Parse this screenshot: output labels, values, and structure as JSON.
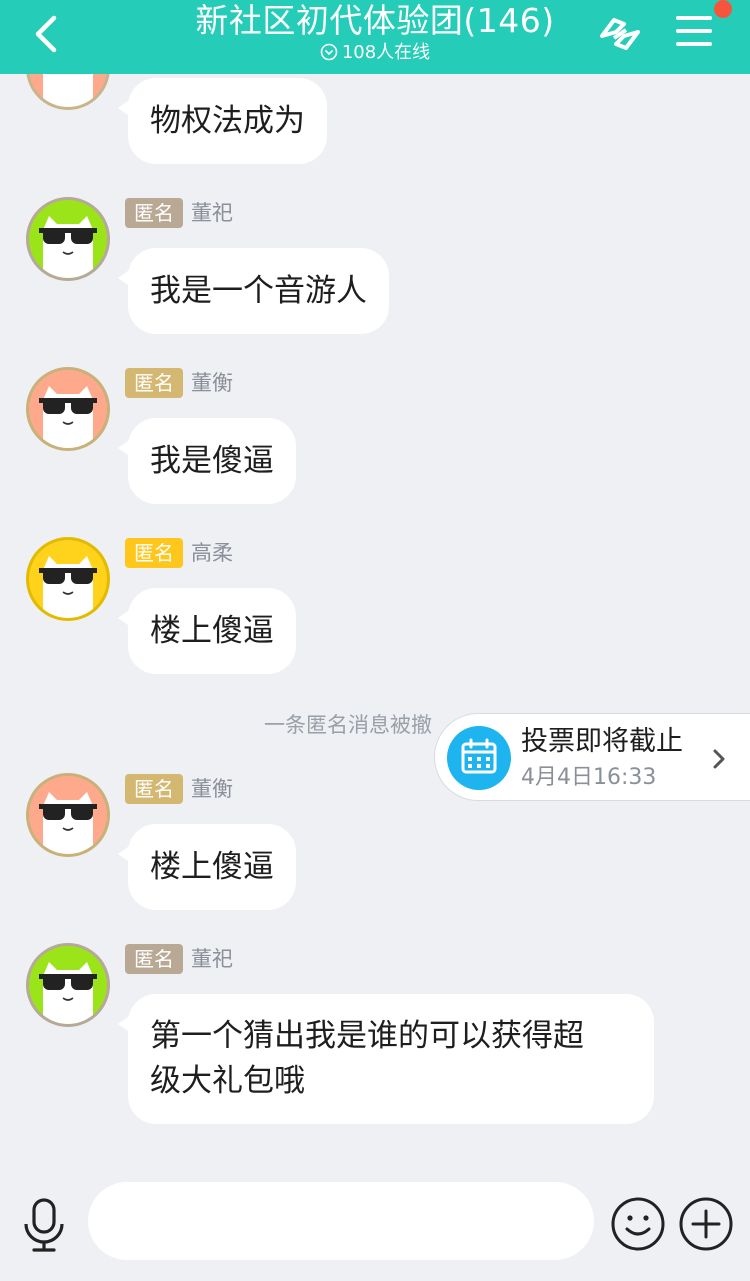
{
  "header": {
    "title": "新社区初代体验团(146)",
    "online": "108人在线",
    "accent": "#25cdb8",
    "notify_color": "#f7543d"
  },
  "messages": [
    {
      "badge": "",
      "nick": "",
      "text": "物权法成为",
      "avatar_color": "#ffa98c"
    },
    {
      "badge": "匿名",
      "nick": "董祀",
      "text": "我是一个音游人",
      "avatar_color": "#9be41a",
      "badge_color": "#b9a893"
    },
    {
      "badge": "匿名",
      "nick": "董衡",
      "text": "我是傻逼",
      "avatar_color": "#ffa98c",
      "badge_color": "#d4b871"
    },
    {
      "badge": "匿名",
      "nick": "高柔",
      "text": "楼上傻逼",
      "avatar_color": "#ffd21b",
      "badge_color": "#ffc71b"
    },
    {
      "badge": "匿名",
      "nick": "董衡",
      "text": "楼上傻逼",
      "avatar_color": "#ffa98c",
      "badge_color": "#d4b871"
    },
    {
      "badge": "匿名",
      "nick": "董祀",
      "text_line1": "第一个猜出我是谁的可以获得超",
      "text_line2": "级大礼包哦",
      "avatar_color": "#9be41a",
      "badge_color": "#b9a893"
    }
  ],
  "system_notice": "一条匿名消息被撤",
  "vote": {
    "title": "投票即将截止",
    "time": "4月4日16:33",
    "icon": "calendar-icon"
  },
  "input": {
    "placeholder": ""
  }
}
